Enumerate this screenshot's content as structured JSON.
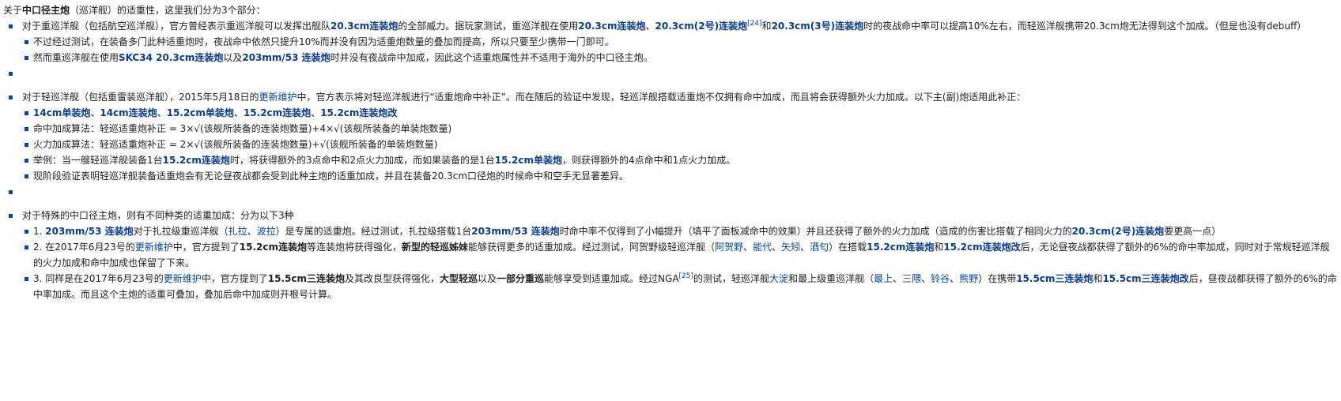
{
  "intro": {
    "t1": "关于",
    "b1": "中口径主炮",
    "t2": "（巡洋舰）的适重性，这里我们分为3个部分："
  },
  "s1": {
    "t1": "对于重巡洋舰（包括航空巡洋舰），官方曾经表示重巡洋舰可以发挥出舰队",
    "l1": "20.3cm连装炮",
    "t2": "的全部威力。据玩家测试，重巡洋舰在使用",
    "l2": "20.3cm连装炮",
    "t3": "、",
    "l3": "20.3cm(2号)连装炮",
    "ref": "[24]",
    "t4": "和",
    "l4": "20.3cm(3号)连装炮",
    "t5": "时的夜战命中率可以提高10%左右，而轻巡洋舰携带20.3cm炮无法得到这个加成。（但是也没有debuff）",
    "sub1": "不过经过测试，在装备多门此种适重炮时，夜战命中依然只提升10%而并没有因为适重炮数量的叠加而提高，所以只要至少携带一门即可。",
    "sub2": {
      "t1": "然而重巡洋舰在使用",
      "l1": "SKC34 20.3cm连装炮",
      "t2": "以及",
      "l2": "203mm/53 连装炮",
      "t3": "时并没有夜战命中加成，因此这个适重炮属性并不适用于海外的中口径主炮。"
    }
  },
  "s2": {
    "t1": "对于轻巡洋舰（包括重雷装巡洋舰），2015年5月18日的",
    "l1": "更新维护",
    "t2": "中，官方表示将对轻巡洋舰进行“适重炮命中补正”。而在随后的验证中发现，轻巡洋舰搭载适重炮不仅拥有命中加成，而且将会获得额外火力加成。以下主(副)炮适用此补正：",
    "guns": {
      "g1": "14cm单装炮",
      "g2": "14cm连装炮",
      "g3": "15.2cm单装炮",
      "g4": "15.2cm连装炮",
      "g5": "15.2cm连装炮改",
      "sep": "、"
    },
    "formula_hit": "命中加成算法：轻巡适重炮补正 = 3×√(该舰所装备的连装炮数量)+4×√(该舰所装备的单装炮数量)",
    "formula_fire": "火力加成算法：轻巡适重炮补正 = 2×√(该舰所装备的连装炮数量)+√(该舰所装备的单装炮数量)",
    "example": {
      "t1": "举例：当一艘轻巡洋舰装备1台",
      "l1": "15.2cm连装炮",
      "t2": "时，将获得额外的3点命中和2点火力加成，而如果装备的是1台",
      "l2": "15.2cm单装炮",
      "t3": "，则获得额外的4点命中和1点火力加成。"
    },
    "note": "现阶段验证表明轻巡洋舰装备适重炮会有无论昼夜战都会受到此种主炮的适重加成，并且在装备20.3cm口径炮的时候命中和空手无显著差异。"
  },
  "s3": {
    "t1": "对于特殊的中口径主炮，则有不同种类的适重加成：分为以下3种",
    "item1": {
      "n": "1. ",
      "l1": "203mm/53 连装炮",
      "t1": "对于扎拉级重巡洋舰（",
      "l2": "扎拉",
      "t2": "、",
      "l3": "波拉",
      "t3": "）是专属的适重炮。经过测试，扎拉级搭载1台",
      "l4": "203mm/53 连装炮",
      "t4": "时命中率不仅得到了小幅提升（填平了面板减命中的效果）并且还获得了额外的火力加成（造成的伤害比搭载了相同火力的",
      "l5": "20.3cm(2号)连装炮",
      "t5": "要更高一点）"
    },
    "item2": {
      "n": "2. 在2017年6月23号的",
      "l1": "更新维护",
      "t1": "中，官方提到了",
      "b1": "15.2cm连装炮",
      "t2": "等连装炮将获得强化，",
      "b2": "新型的轻巡姊妹",
      "t3": "能够获得更多的适重加成。经过测试，阿贺野级轻巡洋舰（",
      "l2": "阿贺野",
      "t4": "、",
      "l3": "能代",
      "t5": "、",
      "l4": "矢矧",
      "t6": "、",
      "l5": "酒匂",
      "t7": "）在搭载",
      "l6": "15.2cm连装炮",
      "t8": "和",
      "l7": "15.2cm连装炮改",
      "t9": "后，无论昼夜战都获得了额外的6%的命中率加成，同时对于常规轻巡洋舰的火力加成和命中加成也保留了下来。"
    },
    "item3": {
      "n": "3. 同样是在2017年6月23号的",
      "l1": "更新维护",
      "t1": "中，官方提到了",
      "b1": "15.5cm三连装炮",
      "t2": "及其改良型获得强化，",
      "b2": "大型轻巡",
      "t3": "以及",
      "b3": "一部分重巡",
      "t4": "能够享受到适重加成。经过NGA",
      "ref": "[25]",
      "t5": "的测试，轻巡洋舰",
      "l2": "大淀",
      "t6": "和最上级重巡洋舰（",
      "l3": "最上",
      "t7": "、",
      "l4": "三隈",
      "t8": "、",
      "l5": "铃谷",
      "t9": "、",
      "l6": "熊野",
      "t10": "）在携带",
      "l7": "15.5cm三连装炮",
      "t11": "和",
      "l8": "15.5cm三连装炮改",
      "t12": "后，昼夜战都获得了额外的6%的命中率加成。而且这个主炮的适重可叠加，叠加后命中加成则开根号计算。"
    }
  }
}
